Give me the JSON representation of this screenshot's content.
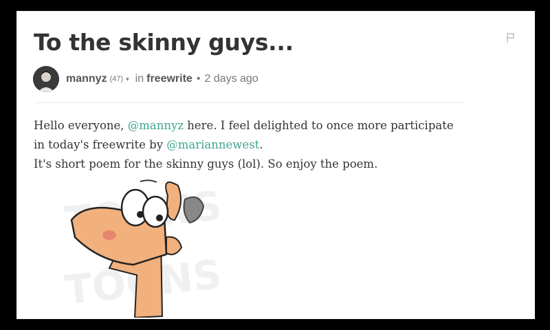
{
  "post": {
    "title": "To the skinny guys...",
    "author": "mannyz",
    "reputation": "(47)",
    "in_label": "in",
    "community": "freewrite",
    "separator": "•",
    "time_ago": "2 days ago",
    "caret_glyph": "▾"
  },
  "body": {
    "line1_prefix": "Hello everyone, ",
    "line1_mention": "@mannyz",
    "line1_suffix": " here. I feel delighted to once more participate",
    "line2_prefix": "in today's freewrite by ",
    "line2_mention": "@mariannewest",
    "line2_suffix": ".",
    "line3": "It's short poem for the skinny guys (lol). So enjoy the poem.",
    "watermark": "TOONS"
  },
  "icons": {
    "flag": "flag-icon",
    "avatar": "avatar-photo",
    "caret": "chevron-down-icon"
  },
  "colors": {
    "mention": "#3fa58e",
    "title": "#333333",
    "meta": "#777777"
  }
}
